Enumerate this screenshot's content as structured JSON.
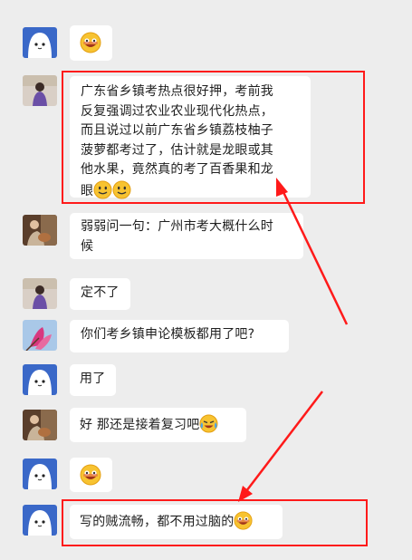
{
  "colors": {
    "background": "#ededed",
    "bubble": "#ffffff",
    "highlight": "#ff1a1a"
  },
  "messages": [
    {
      "sender": "ghost-avatar",
      "emoji": [
        "grinning-face-emoji"
      ],
      "text": ""
    },
    {
      "sender": "girl-avatar",
      "text": "广东省乡镇考热点很好押，考前我\n反复强调过农业农业现代化热点，\n而且说过以前广东省乡镇荔枝柚子\n菠萝都考过了，估计就是龙眼或其\n他水果，竟然真的考了百香果和龙\n眼",
      "emoji": [
        "smile-emoji",
        "smile-emoji"
      ]
    },
    {
      "sender": "guitar-avatar",
      "text": "弱弱问一句：广州市考大概什么时\n候",
      "emoji": []
    },
    {
      "sender": "girl-avatar",
      "text": "定不了",
      "emoji": []
    },
    {
      "sender": "flower-avatar",
      "text": "你们考乡镇申论模板都用了吧?",
      "emoji": []
    },
    {
      "sender": "ghost-avatar",
      "text": "用了",
      "emoji": []
    },
    {
      "sender": "guitar-avatar",
      "text": "好 那还是接着复习吧",
      "emoji": [
        "crying-laugh-emoji"
      ]
    },
    {
      "sender": "ghost-avatar",
      "emoji": [
        "grinning-face-emoji"
      ],
      "text": ""
    },
    {
      "sender": "ghost-avatar",
      "text": "写的贼流畅，都不用过脑的",
      "emoji": [
        "grinning-face-emoji"
      ]
    }
  ]
}
